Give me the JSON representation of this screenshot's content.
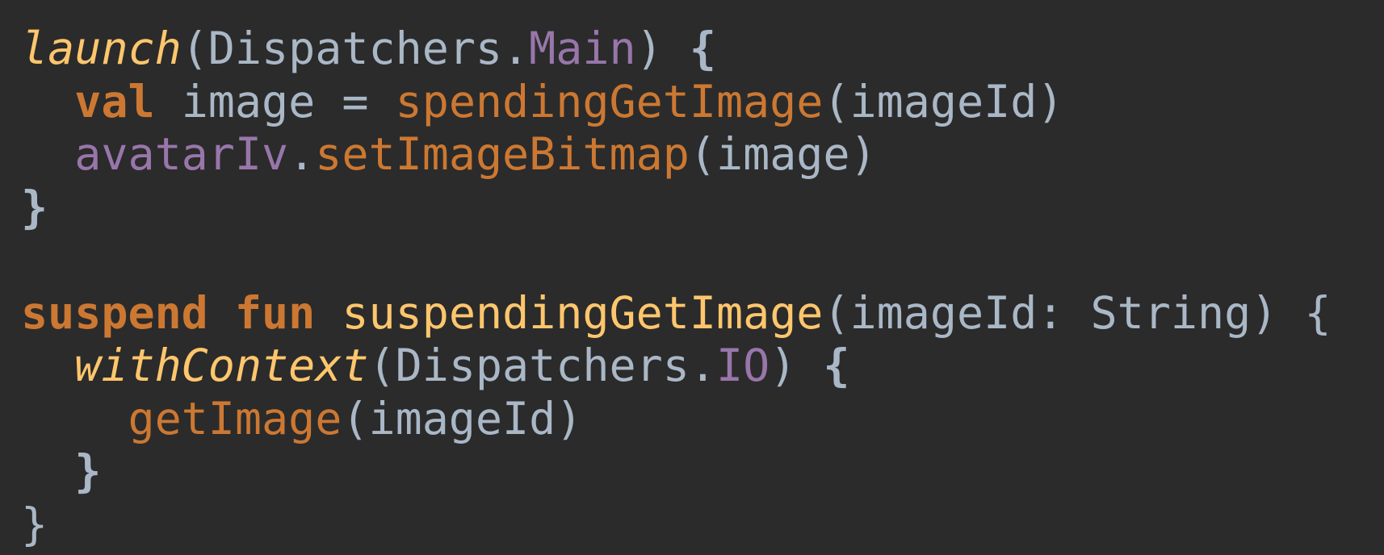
{
  "editor": {
    "colors": {
      "background": "#2b2b2b",
      "plain": "#a9b7c6",
      "keyword": "#cc7832",
      "function_declaration": "#ffc66d",
      "function_call": "#cc7832",
      "property": "#9876aa"
    },
    "lines": [
      {
        "tokens": [
          {
            "text": "launch",
            "kind": "italic-fn"
          },
          {
            "text": "(Dispatchers.",
            "kind": "plain"
          },
          {
            "text": "Main",
            "kind": "property"
          },
          {
            "text": ") ",
            "kind": "plain"
          },
          {
            "text": "{",
            "kind": "brace"
          }
        ]
      },
      {
        "tokens": [
          {
            "text": "  ",
            "kind": "plain"
          },
          {
            "text": "val",
            "kind": "keyword"
          },
          {
            "text": " image = ",
            "kind": "plain"
          },
          {
            "text": "spendingGetImage",
            "kind": "fn-call"
          },
          {
            "text": "(imageId)",
            "kind": "plain"
          }
        ]
      },
      {
        "tokens": [
          {
            "text": "  ",
            "kind": "plain"
          },
          {
            "text": "avatarIv",
            "kind": "property"
          },
          {
            "text": ".",
            "kind": "plain"
          },
          {
            "text": "setImageBitmap",
            "kind": "fn-call"
          },
          {
            "text": "(image)",
            "kind": "plain"
          }
        ]
      },
      {
        "tokens": [
          {
            "text": "}",
            "kind": "brace"
          }
        ]
      },
      {
        "tokens": []
      },
      {
        "tokens": [
          {
            "text": "suspend",
            "kind": "keyword"
          },
          {
            "text": " ",
            "kind": "plain"
          },
          {
            "text": "fun",
            "kind": "keyword"
          },
          {
            "text": " ",
            "kind": "plain"
          },
          {
            "text": "suspendingGetImage",
            "kind": "fn-decl"
          },
          {
            "text": "(imageId: String) {",
            "kind": "plain"
          }
        ]
      },
      {
        "tokens": [
          {
            "text": "  ",
            "kind": "plain"
          },
          {
            "text": "withContext",
            "kind": "italic-fn"
          },
          {
            "text": "(Dispatchers.",
            "kind": "plain"
          },
          {
            "text": "IO",
            "kind": "property"
          },
          {
            "text": ") ",
            "kind": "plain"
          },
          {
            "text": "{",
            "kind": "brace"
          }
        ]
      },
      {
        "tokens": [
          {
            "text": "    ",
            "kind": "plain"
          },
          {
            "text": "getImage",
            "kind": "fn-call"
          },
          {
            "text": "(imageId)",
            "kind": "plain"
          }
        ]
      },
      {
        "tokens": [
          {
            "text": "  ",
            "kind": "plain"
          },
          {
            "text": "}",
            "kind": "brace"
          }
        ]
      },
      {
        "tokens": [
          {
            "text": "}",
            "kind": "plain"
          }
        ]
      }
    ]
  }
}
